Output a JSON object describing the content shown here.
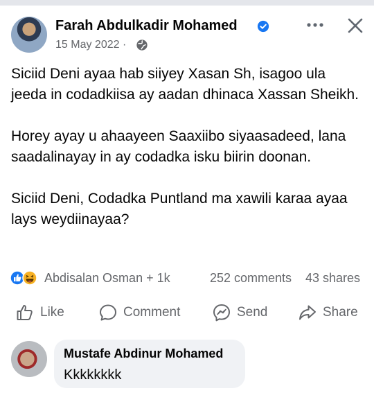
{
  "post": {
    "author": "Farah Abdulkadir Mohamed",
    "date": "15 May 2022 ·",
    "paragraphs": [
      "Siciid Deni ayaa hab siiyey Xasan Sh, isagoo ula jeeda in codadkiisa ay aadan dhinaca Xassan Sheikh.",
      "Horey ayay u ahaayeen Saaxiibo siyaasadeed, lana saadalinayay in ay codadka isku biirin doonan.",
      "Siciid Deni, Codadka Puntland ma xawili karaa ayaa lays weydiinayaa?"
    ],
    "reactions_text": "Abdisalan Osman + 1k",
    "comments_count": "252 comments",
    "shares_count": "43 shares"
  },
  "actions": {
    "like": "Like",
    "comment": "Comment",
    "send": "Send",
    "share": "Share"
  },
  "comment": {
    "author": "Mustafe Abdinur Mohamed",
    "text": "Kkkkkkkk"
  },
  "colors": {
    "facebook_blue": "#1877f2",
    "muted_text": "#65676b",
    "bubble_bg": "#f0f2f5"
  },
  "icons": [
    "verified-badge-icon",
    "globe-icon",
    "more-options-icon",
    "close-icon",
    "like-reaction-icon",
    "haha-reaction-icon",
    "thumbs-up-icon",
    "comment-bubble-icon",
    "messenger-icon",
    "share-arrow-icon"
  ]
}
